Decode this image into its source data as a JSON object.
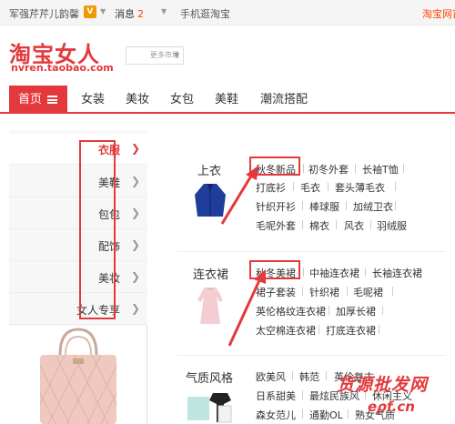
{
  "topbar": {
    "username": "军强芹芹儿韵馨",
    "vip_badge": "V",
    "messages_label": "消息",
    "messages_count": "2",
    "mobile_label": "手机逛淘宝",
    "right_label": "淘宝网首"
  },
  "logo": {
    "title": "淘宝女人",
    "subtitle": "nvren.taobao.com",
    "market_select": "更多市场"
  },
  "nav": {
    "home": "首页",
    "items": [
      "女装",
      "美妆",
      "女包",
      "美鞋",
      "潮流搭配"
    ]
  },
  "sidebar": {
    "categories": [
      "衣服",
      "美鞋",
      "包包",
      "配饰",
      "美妆",
      "女人专享"
    ]
  },
  "groups": [
    {
      "title": "上衣",
      "links": [
        "秋冬新品",
        "初冬外套",
        "长袖T恤",
        "打底衫",
        "毛衣",
        "套头薄毛衣",
        "针织开衫",
        "棒球服",
        "加绒卫衣",
        "毛呢外套",
        "棉衣",
        "风衣",
        "羽绒服"
      ]
    },
    {
      "title": "连衣裙",
      "links": [
        "秋冬美裙",
        "中袖连衣裙",
        "长袖连衣裙",
        "裙子套装",
        "针织裙",
        "毛呢裙",
        "英伦格纹连衣裙",
        "加厚长裙",
        "太空棉连衣裙",
        "打底连衣裙"
      ]
    },
    {
      "title": "气质风格",
      "links": [
        "欧美风",
        "韩范",
        "英伦复古",
        "日系甜美",
        "最炫民族风",
        "休闲主义",
        "森女范儿",
        "通勤OL",
        "熟女气质"
      ]
    }
  ],
  "watermark": {
    "line1": "货源批发网",
    "line2": "eρf.cn"
  },
  "colors": {
    "accent": "#e4393c",
    "orange": "#f39800"
  }
}
